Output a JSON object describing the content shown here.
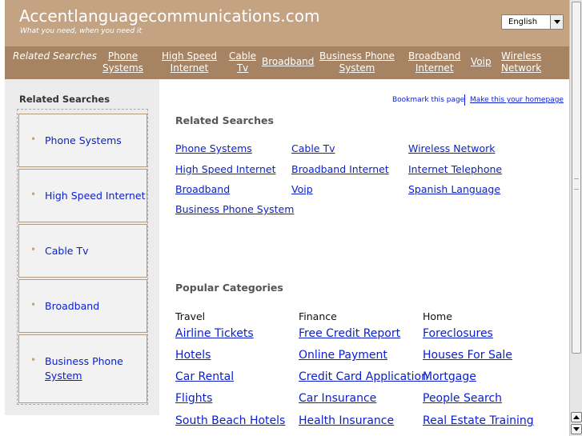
{
  "header": {
    "title": "Accentlanguagecommunications.com",
    "tagline": "What you need, when you need it",
    "language": "English"
  },
  "nav": {
    "label": "Related Searches",
    "links": [
      {
        "line1": "Phone",
        "line2": "Systems"
      },
      {
        "line1": "High Speed",
        "line2": "Internet"
      },
      {
        "line1": "Cable",
        "line2": "Tv"
      },
      {
        "line1": "Broadband",
        "line2": ""
      },
      {
        "line1": "Business Phone",
        "line2": "System"
      },
      {
        "line1": "Broadband",
        "line2": "Internet"
      },
      {
        "line1": "Voip",
        "line2": ""
      },
      {
        "line1": "Wireless",
        "line2": "Network"
      }
    ]
  },
  "sidebar": {
    "title": "Related Searches",
    "items": [
      {
        "line1": "Phone Systems",
        "line2": ""
      },
      {
        "line1": "High Speed Internet",
        "line2": ""
      },
      {
        "line1": "Cable Tv",
        "line2": ""
      },
      {
        "line1": "Broadband",
        "line2": ""
      },
      {
        "line1": "Business Phone",
        "line2": "System"
      }
    ]
  },
  "main": {
    "bookmark": "Bookmark this page",
    "homepage": "Make this your homepage",
    "related_title": "Related Searches",
    "related_links": [
      "Phone Systems",
      "Cable Tv",
      "Wireless Network",
      "High Speed Internet",
      "Broadband Internet",
      "Internet Telephone",
      "Broadband",
      "Voip",
      "Spanish Language",
      "Business Phone System"
    ],
    "popular_title": "Popular Categories",
    "categories": [
      {
        "name": "Travel",
        "links": [
          "Airline Tickets",
          "Hotels",
          "Car Rental",
          "Flights",
          "South Beach Hotels"
        ]
      },
      {
        "name": "Finance",
        "links": [
          "Free Credit Report",
          "Online Payment",
          "Credit Card Application",
          "Car Insurance",
          "Health Insurance"
        ]
      },
      {
        "name": "Home",
        "links": [
          "Foreclosures",
          "Houses For Sale",
          "Mortgage",
          "People Search",
          "Real Estate Training"
        ]
      }
    ]
  },
  "colors": {
    "header_bg": "#c4a383",
    "nav_bg": "#a58363",
    "link": "#0a1ecc",
    "sidebar_bg": "#ececec"
  }
}
